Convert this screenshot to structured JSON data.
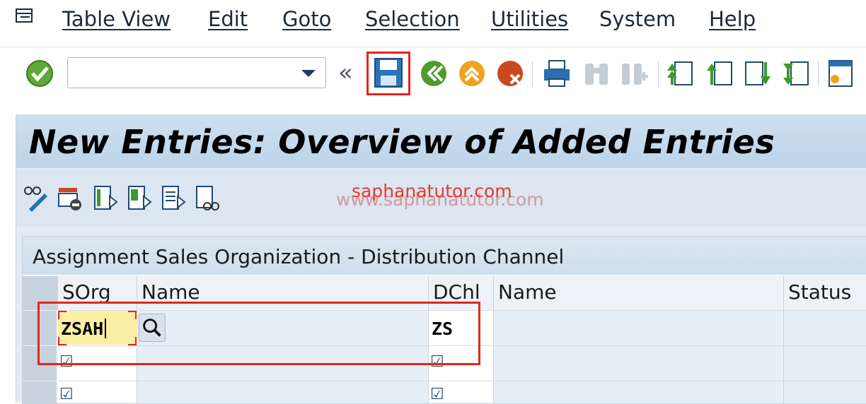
{
  "menu": {
    "items": [
      {
        "label": "Table View"
      },
      {
        "label": "Edit"
      },
      {
        "label": "Goto"
      },
      {
        "label": "Selection"
      },
      {
        "label": "Utilities"
      },
      {
        "label": "System"
      },
      {
        "label": "Help"
      }
    ]
  },
  "toolbar": {
    "command_field_value": "",
    "icons": [
      "enter-icon",
      "command-dropdown-icon",
      "collapse-chevron-icon",
      "save-icon",
      "back-icon",
      "exit-icon",
      "cancel-icon",
      "print-icon",
      "find-icon",
      "find-next-icon",
      "first-page-icon",
      "previous-page-icon",
      "next-page-icon",
      "last-page-icon",
      "customize-layout-icon"
    ],
    "chevron": "«"
  },
  "page": {
    "title": "New Entries: Overview of Added Entries"
  },
  "app_toolbar": {
    "icons": [
      "display-change-icon",
      "delete-row-icon",
      "select-all-icon",
      "select-block-icon",
      "deselect-all-icon",
      "check-icon"
    ]
  },
  "watermark": {
    "line1": "saphanatutor.com",
    "line2": "www.saphanatutor.com"
  },
  "table": {
    "title": "Assignment Sales Organization - Distribution Channel",
    "columns": [
      {
        "label": "SOrg"
      },
      {
        "label": "Name"
      },
      {
        "label": "DChl"
      },
      {
        "label": "Name"
      },
      {
        "label": "Status"
      }
    ],
    "rows": [
      {
        "sorg": "ZSAH",
        "sorg_name": "",
        "dchl": "ZS",
        "dchl_name": "",
        "status": ""
      },
      {
        "sorg": "",
        "sorg_name": "",
        "dchl": "",
        "dchl_name": "",
        "status": ""
      },
      {
        "sorg": "",
        "sorg_name": "",
        "dchl": "",
        "dchl_name": "",
        "status": ""
      }
    ]
  },
  "colors": {
    "highlight_border": "#e6241b",
    "title_bg": "#c6d9ec",
    "input_highlight": "#fcefa5"
  }
}
